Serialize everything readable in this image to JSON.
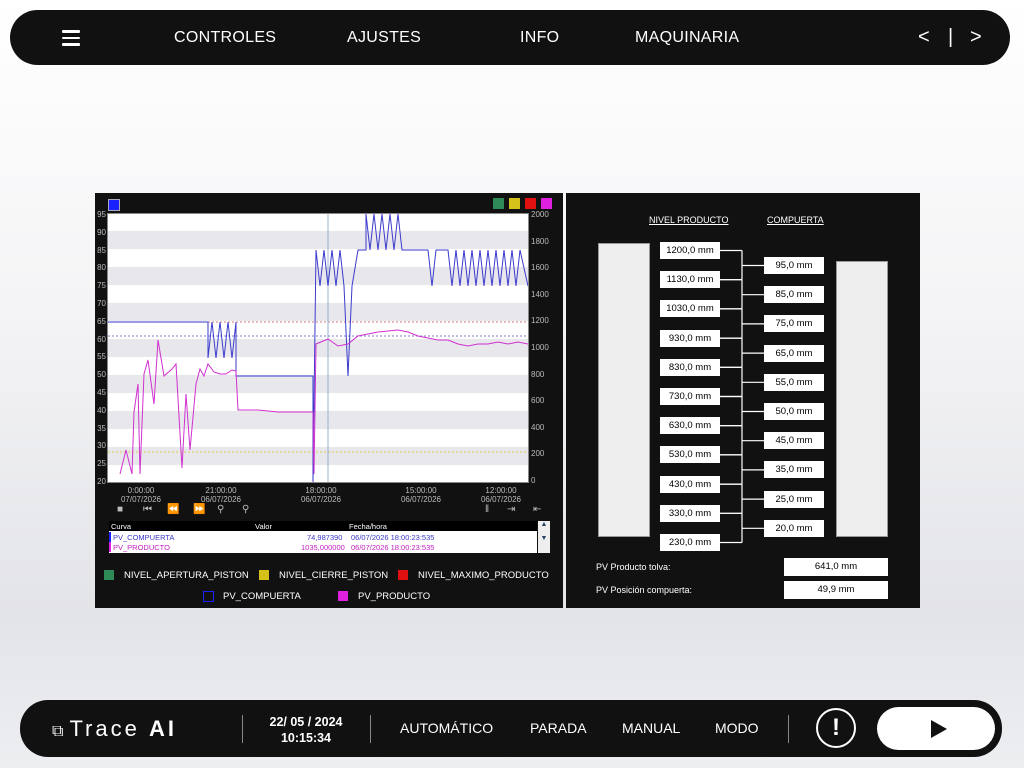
{
  "nav": {
    "items": [
      "CONTROLES",
      "AJUSTES",
      "INFO",
      "MAQUINARIA"
    ],
    "arrows": {
      "prev": "<",
      "sep": "|",
      "next": ">"
    }
  },
  "trend": {
    "legend_squares": {
      "green": "#2e8b57",
      "yellow": "#d4c21a",
      "red": "#e01010",
      "magenta": "#e020e0",
      "blue": "#1a20ff"
    },
    "left_ticks": [
      "95",
      "90",
      "85",
      "80",
      "75",
      "70",
      "65",
      "60",
      "55",
      "50",
      "45",
      "40",
      "35",
      "30",
      "25",
      "20"
    ],
    "right_ticks": [
      "2000",
      "1800",
      "1600",
      "1400",
      "1200",
      "1000",
      "800",
      "600",
      "400",
      "200",
      "0"
    ],
    "x_ticks": [
      {
        "time": "0:00:00",
        "date": "07/07/2026"
      },
      {
        "time": "21:00:00",
        "date": "06/07/2026"
      },
      {
        "time": "18:00:00",
        "date": "06/07/2026"
      },
      {
        "time": "15:00:00",
        "date": "06/07/2026"
      },
      {
        "time": "12:00:00",
        "date": "06/07/2026"
      }
    ],
    "table": {
      "headers": {
        "curve": "Curva",
        "value": "Valor",
        "datetime": "Fecha/hora"
      },
      "rows": [
        {
          "curve": "PV_COMPUERTA",
          "value": "74,987390",
          "datetime": "06/07/2026 18:00:23:535",
          "color": "#3a3acc"
        },
        {
          "curve": "PV_PRODUCTO",
          "value": "1035,000000",
          "datetime": "06/07/2026 18:00:23:535",
          "color": "#c020c0"
        }
      ]
    },
    "legend": [
      {
        "label": "NIVEL_APERTURA_PISTON",
        "color": "#2e8b57"
      },
      {
        "label": "NIVEL_CIERRE_PISTON",
        "color": "#d4c21a"
      },
      {
        "label": "NIVEL_MAXIMO_PRODUCTO",
        "color": "#e01010"
      },
      {
        "label": "PV_COMPUERTA",
        "color": "#1a20ff"
      },
      {
        "label": "PV_PRODUCTO",
        "color": "#e020e0"
      }
    ]
  },
  "levels": {
    "header_product": "NIVEL PRODUCTO",
    "header_gate": "COMPUERTA",
    "product": [
      "1200,0  mm",
      "1130,0  mm",
      "1030,0  mm",
      "930,0  mm",
      "830,0  mm",
      "730,0  mm",
      "630,0  mm",
      "530,0  mm",
      "430,0  mm",
      "330,0  mm",
      "230,0  mm"
    ],
    "gate": [
      "95,0  mm",
      "85,0  mm",
      "75,0  mm",
      "65,0  mm",
      "55,0  mm",
      "50,0  mm",
      "45,0  mm",
      "35,0  mm",
      "25,0  mm",
      "20,0  mm"
    ],
    "pv_product_label": "PV Producto tolva:",
    "pv_product_value": "641,0  mm",
    "pv_gate_label": "PV Posición compuerta:",
    "pv_gate_value": "49,9  mm"
  },
  "footer": {
    "logo_text": "Trace",
    "logo_ai": "AI",
    "date": "22/ 05 / 2024",
    "time": "10:15:34",
    "modes": [
      "AUTOMÁTICO",
      "PARADA",
      "MANUAL",
      "MODO"
    ],
    "alert": "!"
  }
}
